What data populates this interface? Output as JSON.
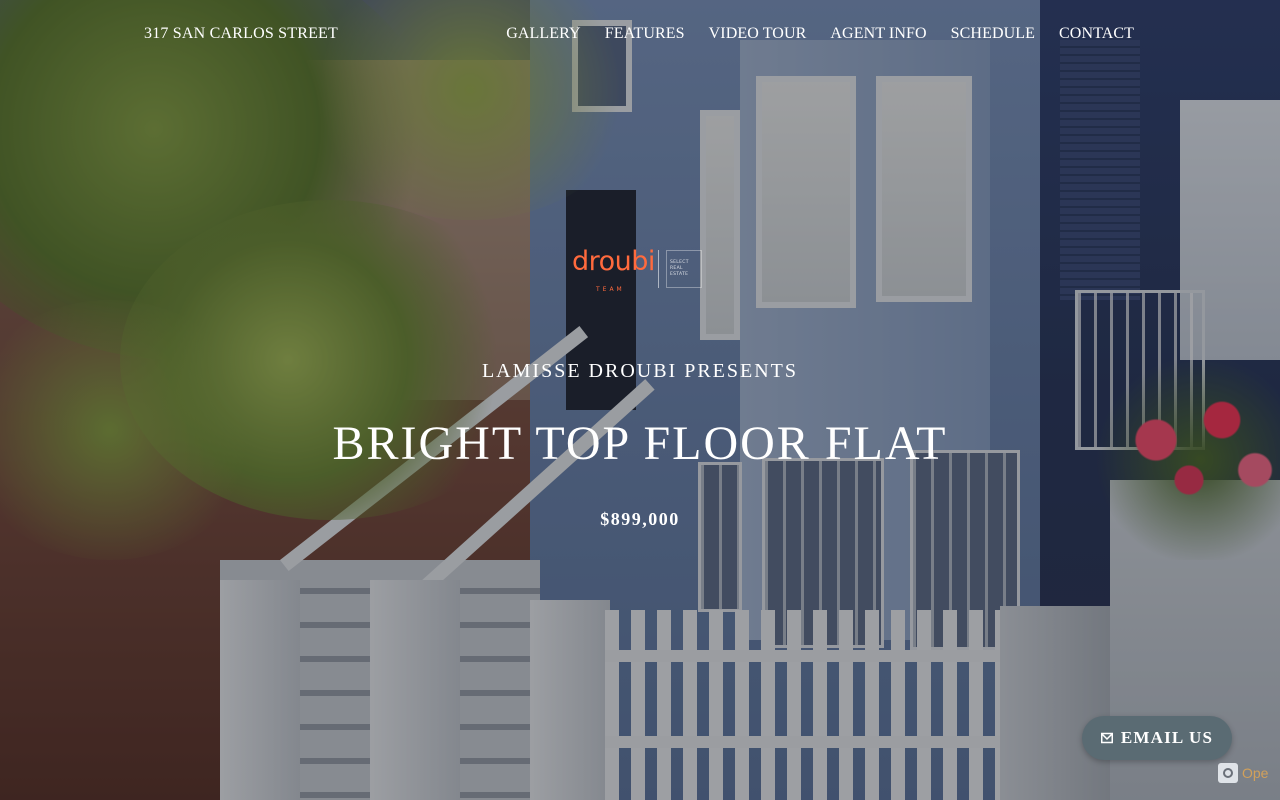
{
  "header": {
    "address": "317 SAN CARLOS STREET",
    "nav": [
      "GALLERY",
      "FEATURES",
      "VIDEO TOUR",
      "AGENT INFO",
      "SCHEDULE",
      "CONTACT"
    ]
  },
  "logo": {
    "wordmark": "droubi",
    "subline": "TEAM",
    "partner_lines": [
      "SELECT",
      "REAL",
      "ESTATE"
    ]
  },
  "hero": {
    "presents": "LAMISSE DROUBI PRESENTS",
    "headline": "BRIGHT TOP FLOOR FLAT",
    "price": "$899,000"
  },
  "cta": {
    "email_label": "EMAIL US"
  },
  "corner_badge": {
    "text": "Ope"
  },
  "colors": {
    "accent": "#ff6a3d",
    "button_bg": "#5a6b73"
  },
  "icons": {
    "email": "envelope-icon",
    "badge": "camera-icon"
  }
}
